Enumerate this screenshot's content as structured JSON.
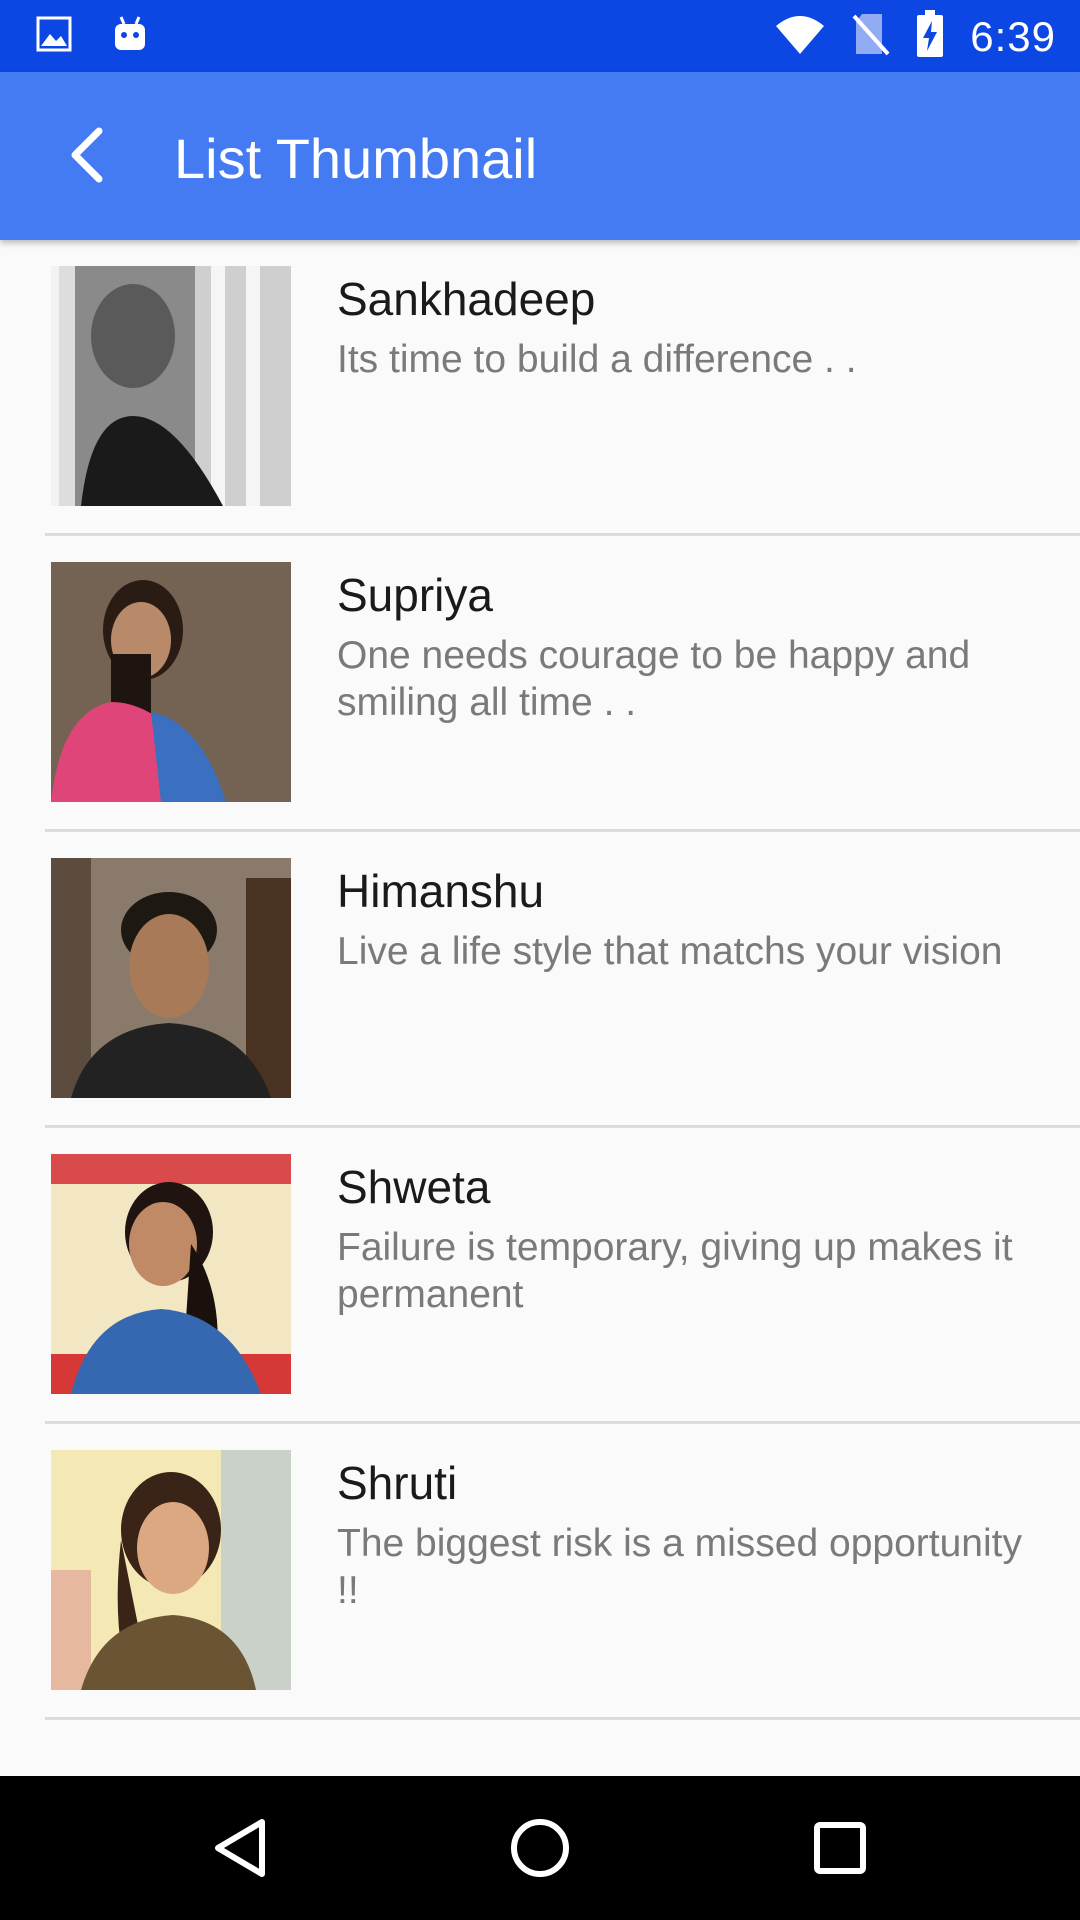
{
  "status_bar": {
    "time": "6:39",
    "left_icons": [
      "image-icon",
      "android-icon"
    ],
    "right_icons": [
      "wifi-icon",
      "no-sim-icon",
      "battery-charging-icon"
    ],
    "background": "#0d47e3"
  },
  "app_bar": {
    "title": "List Thumbnail",
    "back_icon": "chevron-left-icon",
    "background": "#447bf2"
  },
  "list": {
    "items": [
      {
        "name": "Sankhadeep",
        "subtitle": "Its time to build a difference . .",
        "thumbnail": "portrait-photo"
      },
      {
        "name": "Supriya",
        "subtitle": "One needs courage to be happy and smiling all time . .",
        "thumbnail": "portrait-photo"
      },
      {
        "name": "Himanshu",
        "subtitle": "Live a life style that matchs your vision",
        "thumbnail": "portrait-photo"
      },
      {
        "name": "Shweta",
        "subtitle": "Failure is temporary, giving up makes it permanent",
        "thumbnail": "portrait-photo"
      },
      {
        "name": "Shruti",
        "subtitle": "The biggest risk is a missed opportunity !!",
        "thumbnail": "portrait-photo"
      }
    ]
  },
  "nav_bar": {
    "buttons": [
      "back-triangle-icon",
      "home-circle-icon",
      "recents-square-icon"
    ]
  }
}
